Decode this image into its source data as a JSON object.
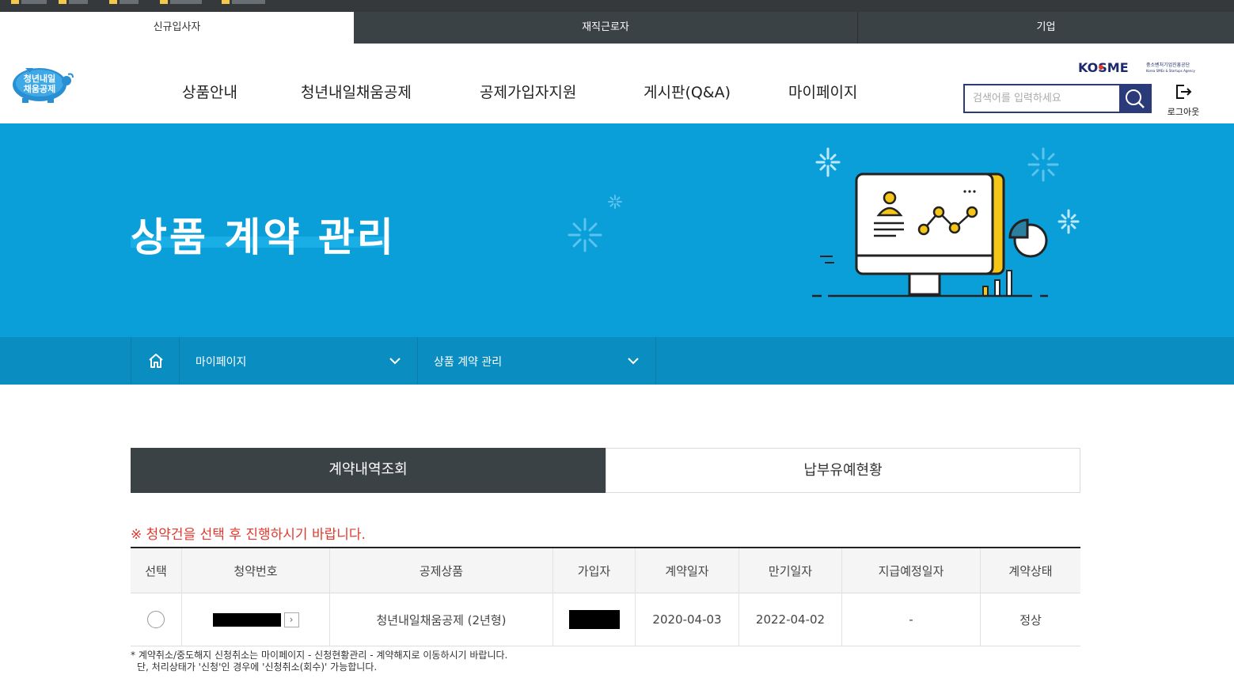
{
  "user_tabs": [
    {
      "label": "신규입사자",
      "active": true
    },
    {
      "label": "재직근로자",
      "active": false
    },
    {
      "label": "기업",
      "active": false
    }
  ],
  "header": {
    "logo_text_line1": "청년내일",
    "logo_text_line2": "채움공제",
    "nav": [
      "상품안내",
      "청년내일채움공제",
      "공제가입자지원",
      "게시판(Q&A)",
      "마이페이지"
    ],
    "org_logo": "KOSME",
    "org_name_kr": "중소벤처기업진흥공단",
    "org_name_en": "Korea SMEs & Startups Agency",
    "search_placeholder": "검색어를 입력하세요",
    "logout_label": "로그아웃"
  },
  "hero": {
    "title": "상품 계약 관리"
  },
  "breadcrumb": {
    "home_icon": "home-icon",
    "level1": "마이페이지",
    "level2": "상품 계약 관리"
  },
  "content_tabs": [
    {
      "label": "계약내역조회",
      "active": true
    },
    {
      "label": "납부유예현황",
      "active": false
    }
  ],
  "notice": "※ 청약건을 선택 후 진행하시기 바랍니다.",
  "table": {
    "columns": [
      "선택",
      "청약번호",
      "공제상품",
      "가입자",
      "계약일자",
      "만기일자",
      "지급예정일자",
      "계약상태"
    ],
    "rows": [
      {
        "product": "청년내일채움공제 (2년형)",
        "contract_date": "2020-04-03",
        "maturity_date": "2022-04-02",
        "payment_date": "-",
        "status": "정상"
      }
    ]
  },
  "footnote_line1": "* 계약취소/중도해지 신청취소는 마이페이지 - 신청현황관리 - 계약해지로 이동하시기 바랍니다.",
  "footnote_line2": "단, 처리상태가 '신청'인 경우에 '신청취소(회수)' 가능합니다.",
  "colors": {
    "hero_bg": "#0a9fd8",
    "breadcrumb_bg": "#0a8ec2",
    "dark_tab": "#3b4246",
    "search_border": "#2b3a78",
    "notice_red": "#e03a2f",
    "accent_yellow": "#f5c518"
  }
}
